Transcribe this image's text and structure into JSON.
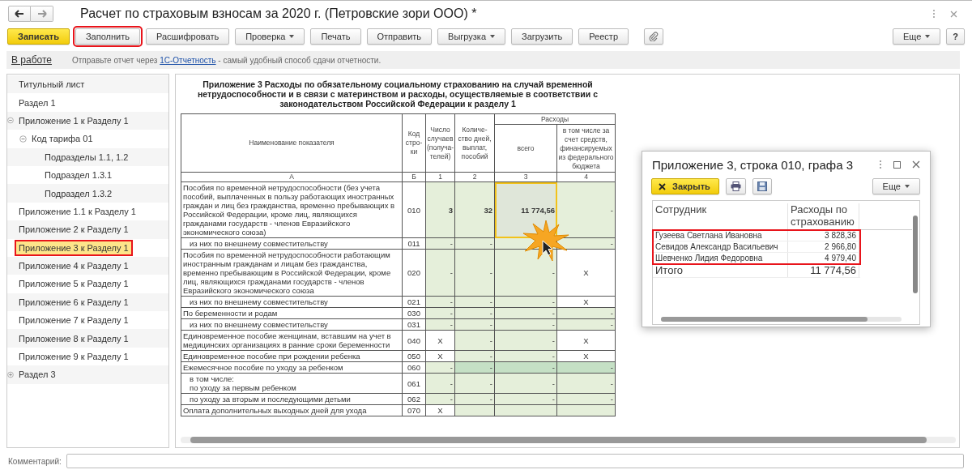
{
  "window": {
    "title": "Расчет по страховым взносам за 2020 г. (Петровские зори ООО) *"
  },
  "toolbar": [
    {
      "label": "Записать",
      "kind": "primary",
      "highlighted": false
    },
    {
      "label": "Заполнить",
      "kind": "button",
      "highlighted": true
    },
    {
      "label": "Расшифровать",
      "kind": "button",
      "highlighted": false
    },
    {
      "label": "Проверка",
      "kind": "dropdown",
      "highlighted": false
    },
    {
      "label": "Печать",
      "kind": "button",
      "highlighted": false
    },
    {
      "label": "Отправить",
      "kind": "button",
      "highlighted": false
    },
    {
      "label": "Выгрузка",
      "kind": "dropdown",
      "highlighted": false
    },
    {
      "label": "Загрузить",
      "kind": "button",
      "highlighted": false
    },
    {
      "label": "Реестр",
      "kind": "button",
      "highlighted": false
    }
  ],
  "toolbar_right": [
    {
      "label": "Еще",
      "kind": "dropdown"
    },
    {
      "label": "?",
      "kind": "button"
    }
  ],
  "status": {
    "link": "В работе",
    "message_before": "Отправьте отчет через ",
    "message_link": "1С-Отчетность",
    "message_after": " - самый удобный способ сдачи отчетности."
  },
  "sidebar": {
    "items": [
      {
        "label": "Титульный лист",
        "selected": false,
        "highlighted": false
      },
      {
        "label": "Раздел 1",
        "selected": false,
        "highlighted": false
      },
      {
        "label": "Приложение 1 к Разделу 1",
        "selected": false,
        "highlighted": false,
        "expanded": true,
        "children": [
          {
            "label": "Код тарифа 01",
            "selected": false,
            "highlighted": false,
            "expanded": true,
            "children": [
              {
                "label": "Подразделы 1.1, 1.2",
                "selected": false,
                "highlighted": false
              },
              {
                "label": "Подраздел 1.3.1",
                "selected": false,
                "highlighted": false
              },
              {
                "label": "Подраздел 1.3.2",
                "selected": false,
                "highlighted": false
              }
            ]
          }
        ]
      },
      {
        "label": "Приложение 1.1 к Разделу 1",
        "selected": false,
        "highlighted": false
      },
      {
        "label": "Приложение 2 к Разделу 1",
        "selected": false,
        "highlighted": false
      },
      {
        "label": "Приложение 3 к Разделу 1",
        "selected": true,
        "highlighted": true
      },
      {
        "label": "Приложение 4 к Разделу 1",
        "selected": false,
        "highlighted": false
      },
      {
        "label": "Приложение 5 к Разделу 1",
        "selected": false,
        "highlighted": false
      },
      {
        "label": "Приложение 6 к Разделу 1",
        "selected": false,
        "highlighted": false
      },
      {
        "label": "Приложение 7 к Разделу 1",
        "selected": false,
        "highlighted": false
      },
      {
        "label": "Приложение 8 к Разделу 1",
        "selected": false,
        "highlighted": false
      },
      {
        "label": "Приложение 9 к Разделу 1",
        "selected": false,
        "highlighted": false
      },
      {
        "label": "Раздел 3",
        "selected": false,
        "highlighted": false,
        "expanded": false
      }
    ]
  },
  "report": {
    "title": "Приложение 3 Расходы по обязательному социальному страхованию на случай временной нетрудоспособности и в связи с материнством и расходы, осуществляемые в соответствии с законодательством Российской Федерации к разделу 1",
    "header": {
      "name": "Наименование показателя",
      "code": "Код стро-ки",
      "col1": "Число случаев (получа-телей)",
      "col2": "Количе-ство дней, выплат, пособий",
      "expenses": "Расходы",
      "col3": "всего",
      "col4": "в том числе за счет средств, финансируемых из федерального бюджета"
    },
    "letters": [
      "А",
      "Б",
      "1",
      "2",
      "3",
      "4"
    ],
    "rows": [
      {
        "name": "Пособия по временной нетрудоспособности (без учета пособий, выплаченных в пользу работающих иностранных граждан и лиц без гражданства, временно пребывающих в Российской Федерации, кроме лиц, являющихся гражданами государств - членов Евразийского экономического союза)",
        "sub": false,
        "code": "010",
        "cells": [
          {
            "text": "3",
            "kind": "filled"
          },
          {
            "text": "32",
            "kind": "filled"
          },
          {
            "text": "11 774,56",
            "kind": "selected"
          },
          {
            "text": "-",
            "kind": "input"
          }
        ]
      },
      {
        "name": "из них по внешнему совместительству",
        "sub": true,
        "code": "011",
        "cells": [
          {
            "text": "-",
            "kind": "input"
          },
          {
            "text": "-",
            "kind": "input"
          },
          {
            "kind": "input"
          },
          {
            "text": "-",
            "kind": "input"
          }
        ]
      },
      {
        "name": "Пособия по временной нетрудоспособности работающим иностранным гражданам и лицам без гражданства, временно пребывающим в Российской Федерации, кроме лиц, являющихся гражданами государств - членов Евразийского экономического союза",
        "sub": false,
        "code": "020",
        "cells": [
          {
            "text": "-",
            "kind": "input"
          },
          {
            "text": "-",
            "kind": "input"
          },
          {
            "text": "-",
            "kind": "input"
          },
          {
            "text": "X",
            "kind": "plain"
          }
        ]
      },
      {
        "name": "из них по внешнему совместительству",
        "sub": true,
        "code": "021",
        "cells": [
          {
            "text": "-",
            "kind": "input"
          },
          {
            "text": "-",
            "kind": "input"
          },
          {
            "text": "-",
            "kind": "input"
          },
          {
            "text": "X",
            "kind": "plain"
          }
        ]
      },
      {
        "name": "По беременности и родам",
        "sub": false,
        "code": "030",
        "cells": [
          {
            "text": "-",
            "kind": "input"
          },
          {
            "text": "-",
            "kind": "input"
          },
          {
            "text": "-",
            "kind": "input"
          },
          {
            "text": "-",
            "kind": "input"
          }
        ]
      },
      {
        "name": "из них по внешнему совместительству",
        "sub": true,
        "code": "031",
        "cells": [
          {
            "text": "-",
            "kind": "input"
          },
          {
            "text": "-",
            "kind": "input"
          },
          {
            "text": "-",
            "kind": "input"
          },
          {
            "text": "-",
            "kind": "input"
          }
        ]
      },
      {
        "name": "Единовременное пособие женщинам, вставшим на учет в медицинских организациях в ранние сроки беременности",
        "sub": false,
        "code": "040",
        "cells": [
          {
            "text": "X",
            "kind": "plain"
          },
          {
            "text": "-",
            "kind": "input"
          },
          {
            "text": "-",
            "kind": "input"
          },
          {
            "text": "X",
            "kind": "plain"
          }
        ]
      },
      {
        "name": "Единовременное пособие при рождении ребенка",
        "sub": false,
        "code": "050",
        "cells": [
          {
            "text": "X",
            "kind": "plain"
          },
          {
            "text": "-",
            "kind": "input"
          },
          {
            "text": "-",
            "kind": "input"
          },
          {
            "text": "X",
            "kind": "plain"
          }
        ]
      },
      {
        "name": "Ежемесячное пособие по уходу за ребенком",
        "sub": false,
        "code": "060",
        "cells": [
          {
            "text": "-",
            "kind": "input"
          },
          {
            "text": "-",
            "kind": "total"
          },
          {
            "text": "-",
            "kind": "total"
          },
          {
            "text": "-",
            "kind": "total"
          }
        ]
      },
      {
        "name": "в том числе:\nпо уходу за первым ребенком",
        "sub": true,
        "code": "061",
        "cells": [
          {
            "text": "-",
            "kind": "input"
          },
          {
            "text": "-",
            "kind": "input"
          },
          {
            "text": "-",
            "kind": "input"
          },
          {
            "text": "-",
            "kind": "input"
          }
        ]
      },
      {
        "name": "по уходу за вторым и последующими детьми",
        "sub": true,
        "code": "062",
        "cells": [
          {
            "text": "-",
            "kind": "input"
          },
          {
            "text": "-",
            "kind": "input"
          },
          {
            "text": "-",
            "kind": "input"
          },
          {
            "text": "-",
            "kind": "input"
          }
        ]
      },
      {
        "name": "Оплата дополнительных выходных дней для ухода",
        "sub": false,
        "code": "070",
        "cells": [
          {
            "text": "X",
            "kind": "plain"
          },
          {
            "kind": "input"
          },
          {
            "kind": "input"
          },
          {
            "kind": "input"
          }
        ]
      }
    ]
  },
  "popup": {
    "title": "Приложение 3, строка 010, графа 3",
    "close_button": "Закрыть",
    "more_button": "Еще",
    "columns": [
      "Сотрудник",
      "Расходы по страхованию"
    ],
    "rows_highlighted": true,
    "rows": [
      {
        "name": "Гузеева Светлана Ивановна",
        "amount": "3 828,36"
      },
      {
        "name": "Севидов Александр Васильевич",
        "amount": "2 966,80"
      },
      {
        "name": "Шевченко Лидия Федоровна",
        "amount": "4 979,40"
      }
    ],
    "total": {
      "label": "Итого",
      "amount": "11 774,56"
    }
  },
  "comment": {
    "label": "Комментарий:"
  }
}
